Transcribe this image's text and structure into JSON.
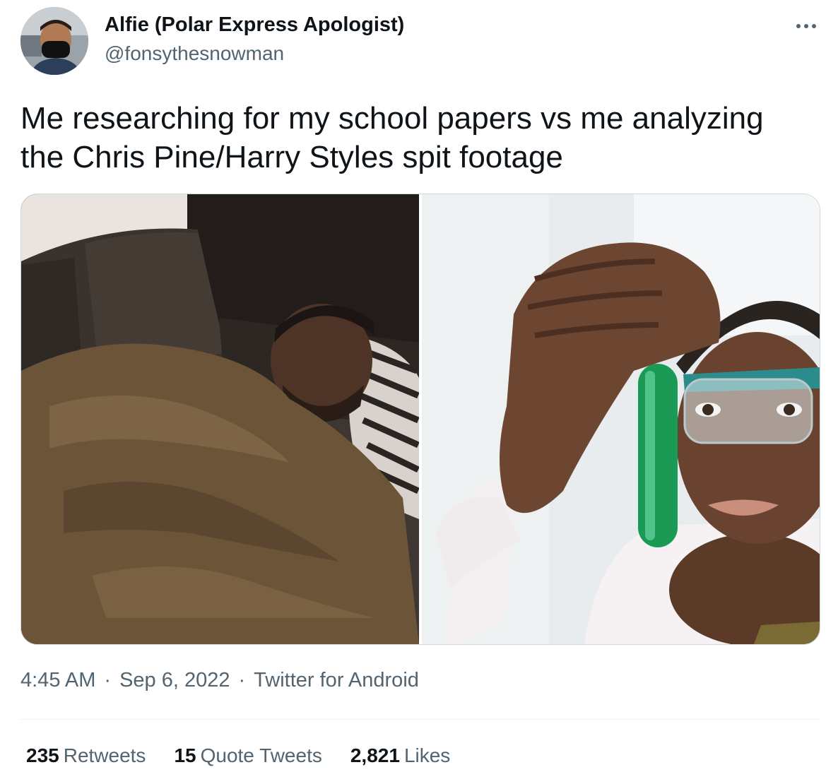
{
  "author": {
    "display_name": "Alfie (Polar Express Apologist)",
    "handle": "@fonsythesnowman",
    "avatar_icon": "user-avatar"
  },
  "menu": {
    "more_icon": "more-horizontal-icon"
  },
  "tweet": {
    "text": "Me researching for my school papers vs me analyzing\nthe Chris Pine/Harry Styles spit footage"
  },
  "media": {
    "images": [
      {
        "icon": "photo-man-sleeping-on-couch"
      },
      {
        "icon": "photo-scientist-examining-test-tube"
      }
    ]
  },
  "meta": {
    "time": "4:45 AM",
    "separator": "·",
    "date": "Sep 6, 2022",
    "source": "Twitter for Android"
  },
  "stats": {
    "retweets_count": "235",
    "retweets_label": "Retweets",
    "quotes_count": "15",
    "quotes_label": "Quote Tweets",
    "likes_count": "2,821",
    "likes_label": "Likes"
  },
  "colors": {
    "text_primary": "#0f1419",
    "text_secondary": "#536471",
    "border": "#cfd9de",
    "divider": "#eff3f4",
    "test_tube_green": "#1a9a55"
  }
}
